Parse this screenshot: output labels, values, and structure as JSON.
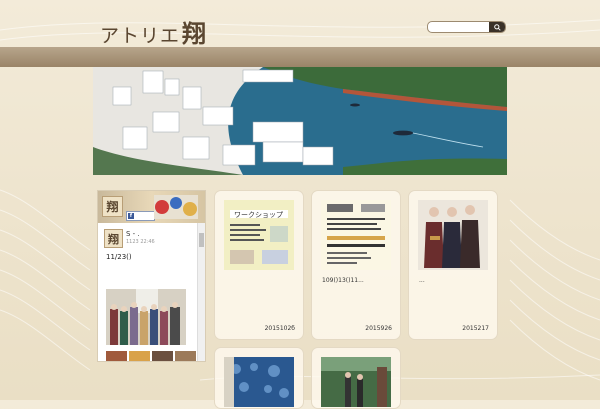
{
  "site": {
    "logo_text": "アトリエ",
    "logo_kanji": "翔"
  },
  "search": {
    "placeholder": "",
    "icon": "search-icon"
  },
  "widget": {
    "logo_kanji": "翔",
    "fb_label": "f",
    "post": {
      "avatar_kanji": "翔",
      "author": "S - .",
      "time": "1123 22:46",
      "date_text": "11/23()",
      "note": "♪"
    }
  },
  "cards": [
    {
      "id": "card-workshop",
      "caption": "",
      "date": "2015102б",
      "title": "ワークショップ"
    },
    {
      "id": "card-exhibit",
      "caption": "109()13()11...",
      "date": "2015926",
      "title": ""
    },
    {
      "id": "card-people",
      "caption": "...",
      "date": "2015217",
      "title": ""
    },
    {
      "id": "card-indigo",
      "caption": "",
      "date": "",
      "title": ""
    },
    {
      "id": "card-garden",
      "caption": "",
      "date": "",
      "title": ""
    }
  ],
  "colors": {
    "band": "#9a8468",
    "sea": "#2a6d8e",
    "background": "#efe6d2"
  }
}
